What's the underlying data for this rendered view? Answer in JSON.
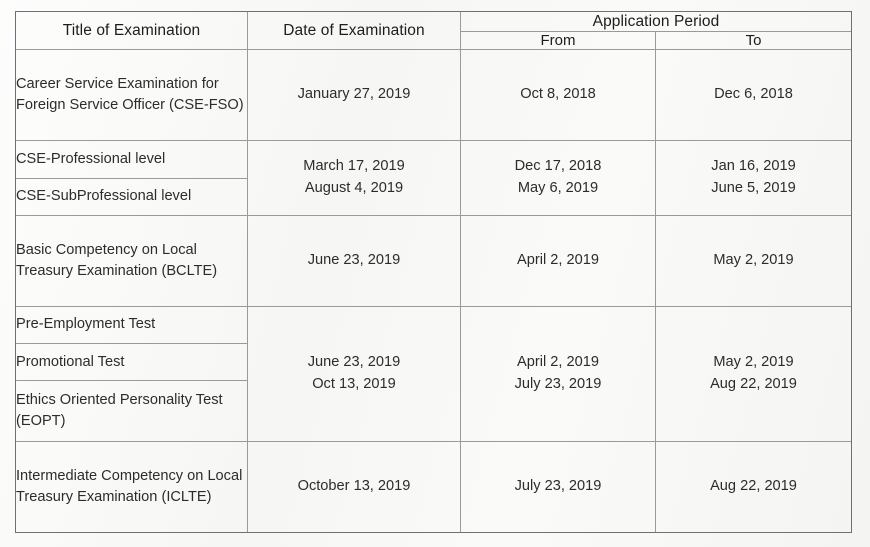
{
  "document": {
    "type": "examination-schedule-table",
    "background_color": "#fbfbfa",
    "text_color": "#2c2c2c",
    "border_color": "#9a9a9e"
  },
  "table": {
    "headers": {
      "title": "Title of Examination",
      "date": "Date of Examination",
      "application_period": "Application Period",
      "from": "From",
      "to": "To"
    },
    "groups": [
      {
        "id": "cse-fso",
        "titles": [
          "Career Service Examination for Foreign Service Officer (CSE-FSO)"
        ],
        "dates": [
          "January 27, 2019"
        ],
        "from": [
          "Oct 8, 2018"
        ],
        "to": [
          "Dec 6, 2018"
        ]
      },
      {
        "id": "cse-levels",
        "titles": [
          "CSE-Professional level",
          "CSE-SubProfessional level"
        ],
        "dates": [
          "March 17, 2019",
          "August 4, 2019"
        ],
        "from": [
          "Dec 17, 2018",
          "May 6, 2019"
        ],
        "to": [
          "Jan 16, 2019",
          "June 5, 2019"
        ]
      },
      {
        "id": "bclte",
        "titles": [
          "Basic Competency on Local Treasury Examination (BCLTE)"
        ],
        "dates": [
          "June 23, 2019"
        ],
        "from": [
          "April 2, 2019"
        ],
        "to": [
          "May 2, 2019"
        ]
      },
      {
        "id": "pet-promo-eopt",
        "titles": [
          "Pre-Employment Test",
          "Promotional Test",
          "Ethics Oriented Personality Test (EOPT)"
        ],
        "dates": [
          "June 23, 2019",
          "Oct 13, 2019"
        ],
        "from": [
          "April 2, 2019",
          "July 23, 2019"
        ],
        "to": [
          "May 2, 2019",
          "Aug 22, 2019"
        ]
      },
      {
        "id": "iclte",
        "titles": [
          "Intermediate Competency on Local Treasury Examination (ICLTE)"
        ],
        "dates": [
          "October 13, 2019"
        ],
        "from": [
          "July 23, 2019"
        ],
        "to": [
          "Aug 22, 2019"
        ]
      }
    ]
  }
}
